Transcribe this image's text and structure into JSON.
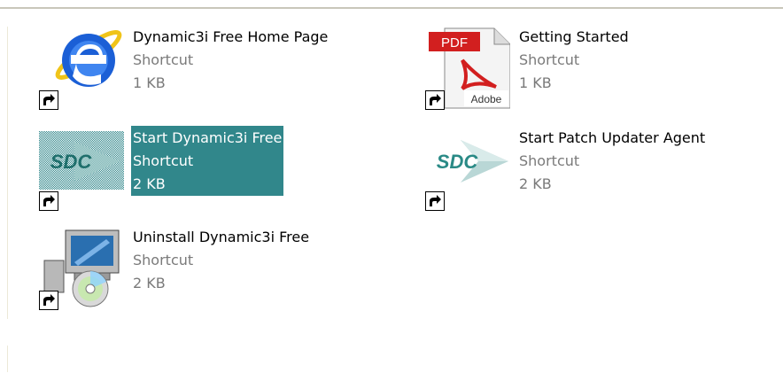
{
  "items": [
    {
      "name": "Dynamic3i Free Home Page",
      "type": "Shortcut",
      "size": "1 KB",
      "icon": "internet-explorer-icon"
    },
    {
      "name": "Getting Started",
      "type": "Shortcut",
      "size": "1 KB",
      "icon": "pdf-document-icon"
    },
    {
      "name": "Start Dynamic3i Free",
      "type": "Shortcut",
      "size": "2 KB",
      "icon": "sdc-logo-icon",
      "selected": true
    },
    {
      "name": "Start Patch Updater Agent",
      "type": "Shortcut",
      "size": "2 KB",
      "icon": "sdc-logo-icon"
    },
    {
      "name": "Uninstall Dynamic3i Free",
      "type": "Shortcut",
      "size": "2 KB",
      "icon": "installer-computer-cd-icon"
    }
  ],
  "icon_text": {
    "pdf_badge": "PDF",
    "adobe": "Adobe",
    "sdc": "SDC"
  },
  "colors": {
    "selection": "#31878b",
    "ie_blue": "#1b5fd6",
    "ie_ring": "#f0c419",
    "pdf_red": "#d21f1f",
    "sdc_teal": "#2a8a86",
    "secondary_text": "#7a7a7a"
  }
}
